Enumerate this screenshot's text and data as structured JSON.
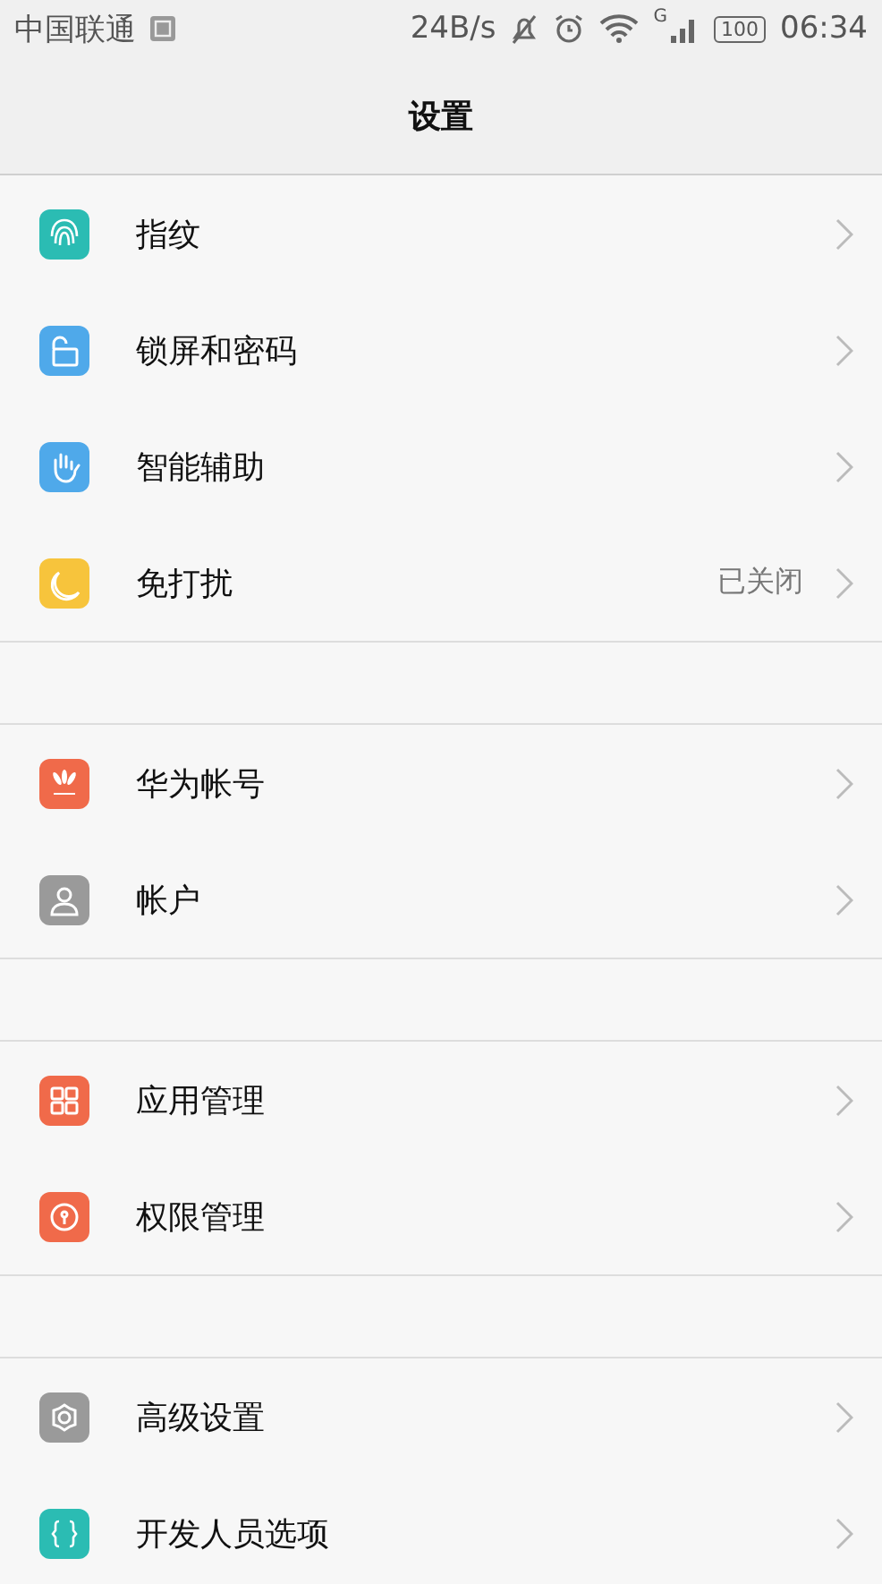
{
  "status_bar": {
    "carrier": "中国联通",
    "speed": "24B/s",
    "network": "G",
    "battery": "100",
    "time": "06:34"
  },
  "title": "设置",
  "groups": [
    {
      "items": [
        {
          "label": "指纹",
          "color": "#2bbcb3"
        },
        {
          "label": "锁屏和密码",
          "color": "#4fa9ea"
        },
        {
          "label": "智能辅助",
          "color": "#4fa9ea"
        },
        {
          "label": "免打扰",
          "color": "#f7c43c",
          "value": "已关闭"
        }
      ]
    },
    {
      "items": [
        {
          "label": "华为帐号",
          "color": "#f06a4a"
        },
        {
          "label": "帐户",
          "color": "#9a9a9a"
        }
      ]
    },
    {
      "items": [
        {
          "label": "应用管理",
          "color": "#f06a4a"
        },
        {
          "label": "权限管理",
          "color": "#f06a4a"
        }
      ]
    },
    {
      "items": [
        {
          "label": "高级设置",
          "color": "#9a9a9a"
        },
        {
          "label": "开发人员选项",
          "color": "#2bbcb3"
        }
      ]
    }
  ]
}
